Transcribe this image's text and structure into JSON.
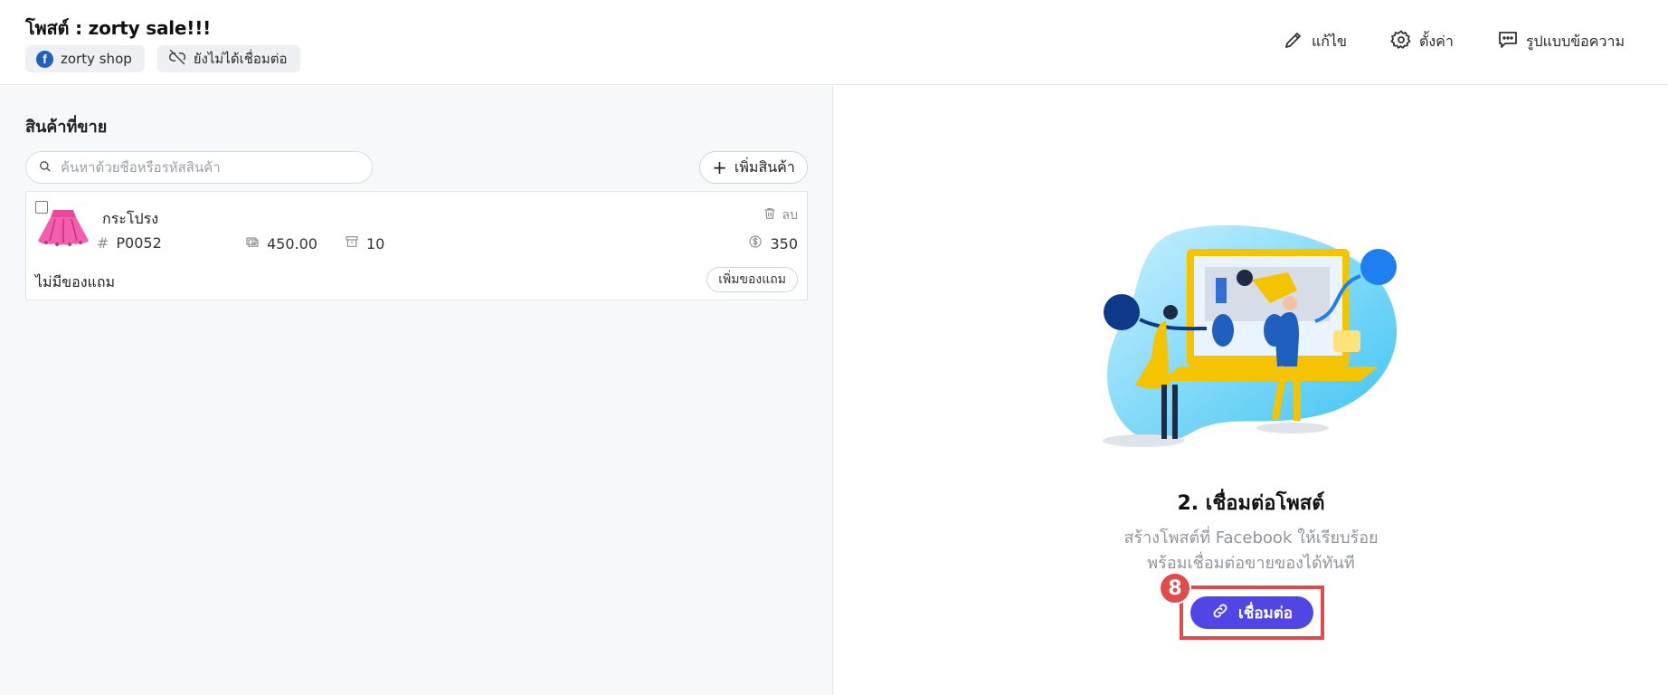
{
  "header": {
    "title": "โพสต์ : zorty sale!!!",
    "page_chip": {
      "icon": "facebook-icon",
      "label": "zorty shop"
    },
    "status_chip": {
      "icon": "link-broken-icon",
      "label": "ยังไม่ได้เชื่อมต่อ"
    },
    "toolbar": [
      {
        "icon": "pencil-icon",
        "label": "แก้ไข"
      },
      {
        "icon": "gear-icon",
        "label": "ตั้งค่า"
      },
      {
        "icon": "chat-bubble-icon",
        "label": "รูปแบบข้อความ"
      }
    ]
  },
  "products": {
    "section_title": "สินค้าที่ขาย",
    "search_placeholder": "ค้นหาด้วยชื่อหรือรหัสสินค้า",
    "add_button_label": "เพิ่มสินค้า",
    "items": [
      {
        "name": "กระโปรง",
        "sku_prefix": "#",
        "sku": "P0052",
        "price": "450.00",
        "stock": "10",
        "sale_price": "350",
        "delete_label": "ลบ",
        "freebie_text": "ไม่มีของแถม",
        "add_freebie_label": "เพิ่มของแถม"
      }
    ]
  },
  "connect_panel": {
    "step_title": "2. เชื่อมต่อโพสต์",
    "description_line1": "สร้างโพสต์ที่ Facebook ให้เรียบร้อย",
    "description_line2": "พร้อมเชื่อมต่อขายของได้ทันที",
    "button_label": "เชื่อมต่อ",
    "annotation_number": "8"
  },
  "colors": {
    "accent": "#5046e5",
    "annotation_red": "#e24b4b",
    "facebook_blue": "#1f5fbf",
    "muted_text": "#8f949b"
  }
}
